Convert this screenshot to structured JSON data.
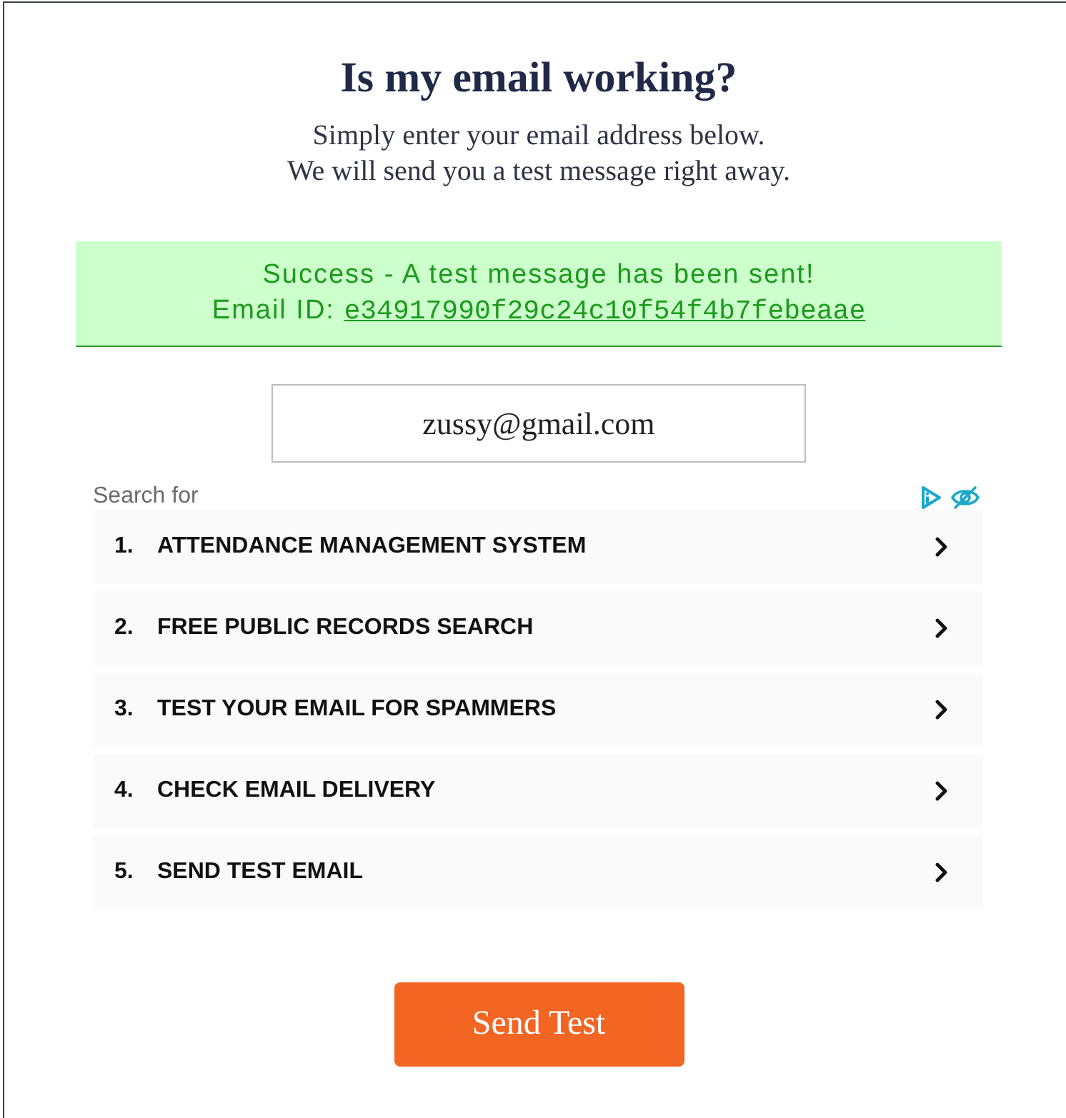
{
  "header": {
    "title": "Is my email working?",
    "subtitle_lines": [
      "Simply enter your email address below.",
      "We will send you a test message right away."
    ]
  },
  "alert": {
    "kind": "success",
    "message": "Success - A test message has been sent!",
    "id_label": "Email ID:",
    "id_link": "e34917990f29c24c10f54f4b7febeaae"
  },
  "email_field": {
    "value": "zussy@gmail.com"
  },
  "ad_block": {
    "heading": "Search for",
    "items": [
      {
        "number": "1.",
        "label": "ATTENDANCE MANAGEMENT SYSTEM"
      },
      {
        "number": "2.",
        "label": "FREE PUBLIC RECORDS SEARCH"
      },
      {
        "number": "3.",
        "label": "TEST YOUR EMAIL FOR SPAMMERS"
      },
      {
        "number": "4.",
        "label": "CHECK EMAIL DELIVERY"
      },
      {
        "number": "5.",
        "label": "SEND TEST EMAIL"
      }
    ]
  },
  "send_button": {
    "label": "Send Test"
  }
}
